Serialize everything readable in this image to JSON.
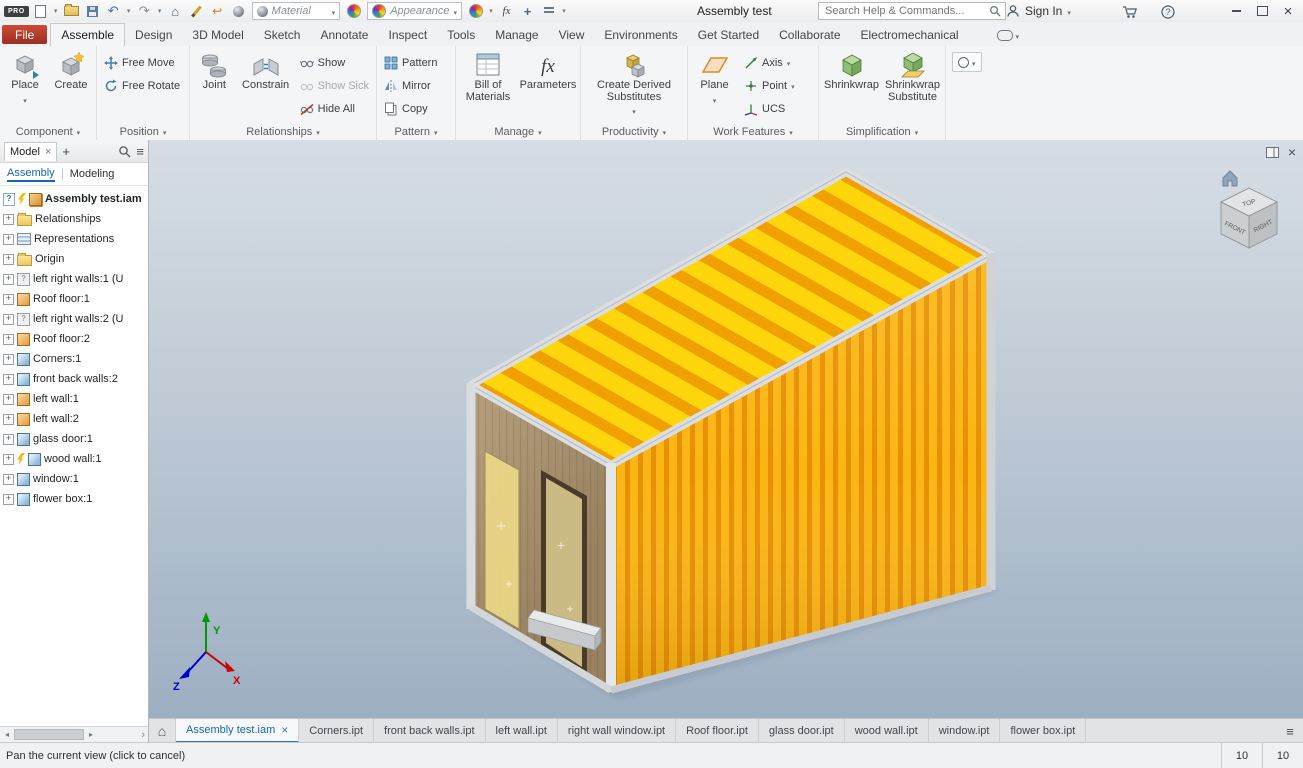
{
  "title_bar": {
    "logo": "PRO",
    "title": "Assembly test",
    "material_label": "Material",
    "appearance_label": "Appearance",
    "search_placeholder": "Search Help & Commands...",
    "sign_in_label": "Sign In"
  },
  "ribbon": {
    "tabs": [
      "File",
      "Assemble",
      "Design",
      "3D Model",
      "Sketch",
      "Annotate",
      "Inspect",
      "Tools",
      "Manage",
      "View",
      "Environments",
      "Get Started",
      "Collaborate",
      "Electromechanical"
    ],
    "active_tab": "Assemble",
    "panels": {
      "component": {
        "label": "Component",
        "place": "Place",
        "create": "Create"
      },
      "position": {
        "label": "Position",
        "free_move": "Free Move",
        "free_rotate": "Free Rotate"
      },
      "relationships": {
        "label": "Relationships",
        "joint": "Joint",
        "constrain": "Constrain",
        "show": "Show",
        "show_sick": "Show Sick",
        "hide_all": "Hide All"
      },
      "pattern": {
        "label": "Pattern",
        "pattern": "Pattern",
        "mirror": "Mirror",
        "copy": "Copy"
      },
      "manage": {
        "label": "Manage",
        "bom": "Bill of Materials",
        "parameters": "Parameters"
      },
      "productivity": {
        "label": "Productivity",
        "derived": "Create Derived Substitutes"
      },
      "work_features": {
        "label": "Work Features",
        "plane": "Plane",
        "axis": "Axis",
        "point": "Point",
        "ucs": "UCS"
      },
      "simplification": {
        "label": "Simplification",
        "shrinkwrap": "Shrinkwrap",
        "shrinkwrap_substitute": "Shrinkwrap Substitute"
      }
    }
  },
  "browser": {
    "tab": "Model",
    "subtab_assembly": "Assembly",
    "subtab_modeling": "Modeling",
    "tree": [
      {
        "label": "Assembly test.iam",
        "icon": "assembly-icon"
      },
      {
        "label": "Relationships",
        "icon": "folder-icon"
      },
      {
        "label": "Representations",
        "icon": "representations-icon"
      },
      {
        "label": "Origin",
        "icon": "folder-icon"
      },
      {
        "label": "left right walls:1 (U",
        "icon": "unresolved-part-icon"
      },
      {
        "label": "Roof floor:1",
        "icon": "part-icon-orange"
      },
      {
        "label": "left right walls:2 (U",
        "icon": "unresolved-part-icon"
      },
      {
        "label": "Roof floor:2",
        "icon": "part-icon-orange"
      },
      {
        "label": "Corners:1",
        "icon": "part-icon-blue"
      },
      {
        "label": "front back walls:2",
        "icon": "part-icon-blue"
      },
      {
        "label": "left wall:1",
        "icon": "part-icon-orange"
      },
      {
        "label": "left wall:2",
        "icon": "part-icon-orange"
      },
      {
        "label": "glass door:1",
        "icon": "part-icon-blue"
      },
      {
        "label": "wood wall:1",
        "icon": "part-icon-blue"
      },
      {
        "label": "window:1",
        "icon": "part-icon-blue"
      },
      {
        "label": "flower box:1",
        "icon": "part-icon-blue"
      }
    ]
  },
  "viewport": {
    "viewcube": {
      "top": "TOP",
      "front": "FRONT",
      "right": "RIGHT"
    },
    "triad": {
      "x": "X",
      "y": "Y",
      "z": "Z"
    },
    "model_colors": {
      "roof_yellow": "#FFD60C",
      "roof_stripe_orange": "#F0A000",
      "wall_light": "#FCB513",
      "wall_dark": "#E79000",
      "wood": "#A8916F",
      "frame_silver": "#D9DCDE",
      "glass": "#EAD887"
    }
  },
  "doc_tabs": {
    "active": "Assembly test.iam",
    "tabs": [
      "Assembly test.iam",
      "Corners.ipt",
      "front back walls.ipt",
      "left wall.ipt",
      "right wall window.ipt",
      "Roof floor.ipt",
      "glass door.ipt",
      "wood wall.ipt",
      "window.ipt",
      "flower box.ipt"
    ]
  },
  "status_bar": {
    "message": "Pan the current view (click to cancel)",
    "value_1": "10",
    "value_2": "10"
  }
}
